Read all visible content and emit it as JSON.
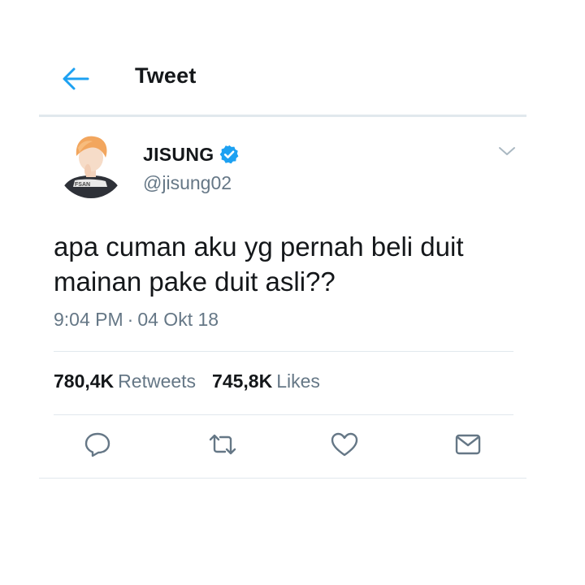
{
  "header": {
    "title": "Tweet",
    "back_icon": "arrow-left-icon",
    "accent": "#1da1f2"
  },
  "user": {
    "display_name": "JISUNG",
    "handle": "@jisung02",
    "verified": true,
    "verified_color": "#1da1f2",
    "avatar_text": "FSAN"
  },
  "tweet": {
    "text": "apa cuman aku yg pernah beli duit mainan pake duit asli??",
    "time": "9:04 PM",
    "separator": "·",
    "date": "04 Okt 18"
  },
  "stats": {
    "retweets_count": "780,4K",
    "retweets_label": "Retweets",
    "likes_count": "745,8K",
    "likes_label": "Likes"
  },
  "actions": [
    "reply-icon",
    "retweet-icon",
    "like-icon",
    "share-icon"
  ],
  "colors": {
    "text": "#14171a",
    "secondary": "#657786",
    "divider": "#e1e8ed"
  }
}
